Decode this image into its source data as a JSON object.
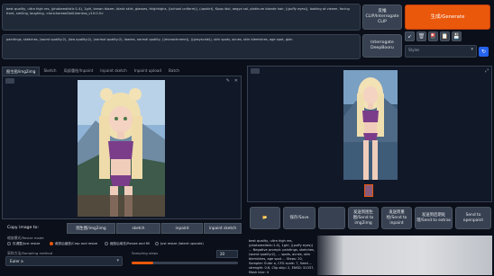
{
  "prompts": {
    "positive": "best quality, ultra high res, (photorealistic:1.4), 1girl, brown blazer, black skirt, glasses, thighhighs, ((school uniform)), (upskirt), Kpop idol, aegyo sal, platinum blonde hair, ((puffy eyes)), looking at viewer, facing front, smiling, laughing, <lora:koreanDollLikeness_v10:0.5>",
    "negative": "paintings, sketches, (worst quality:2), (low quality:2), (normal quality:2), lowres, normal quality, ((monochrome)), ((grayscale)), skin spots, acnes, skin blemishes, age spot, glan"
  },
  "buttons": {
    "interrogate_clip": "反推\nCLIP/Interrogate CLIP",
    "generate": "生成/Generate",
    "interrogate_deepbooru": "Interrogate DeepBooru",
    "styles_label": "Styles"
  },
  "toolbar_icons": [
    "↙",
    "🗑",
    "🎴",
    "📋",
    "💾"
  ],
  "tabs": [
    "图生图/img2img",
    "Sketch",
    "局部重绘/Inpaint",
    "Inpaint sketch",
    "Inpaint upload",
    "Batch"
  ],
  "copy_image_to": {
    "label": "Copy image to:",
    "buttons": [
      "图生图/img2img",
      "sketch",
      "inpaint",
      "inpaint sketch"
    ]
  },
  "resize_mode": {
    "label": "缩放模式/Resize mode",
    "options": [
      "仅调整/Just resize",
      "裁剪后缩放/Crop and resize",
      "缩放后填充/Resize and fill",
      "Just resize (latent upscale)"
    ],
    "selected": 1
  },
  "sampling": {
    "method_label": "采样方法/Sampling method",
    "method_value": "Euler a",
    "steps_label": "Sampling steps",
    "steps_value": "20",
    "steps_fraction": 0.2
  },
  "output_buttons": [
    "📂",
    "保存/Save",
    "",
    "发送到图生图/Send to img2img",
    "发送到重绘/Send to inpaint",
    "发送到后期处理/Send to extras",
    "Send to openpaint"
  ],
  "output_info": "best quality, ultra high res, (photorealistic:1.4), 1girl, ((puffy eyes)) ... Negative prompt: paintings, sketches, (worst quality:2), ... spots, acnes, skin blemishes, age spot ... Steps: 20, Sampler: Euler a, CFG scale: 7, Seed ... strength: 0.6, Clip skip: 2, ENSD: 31337, Mask blur: 4",
  "colors": {
    "accent": "#ea580c",
    "background": "#0b0f19",
    "panel": "#111827",
    "button": "#374151"
  }
}
